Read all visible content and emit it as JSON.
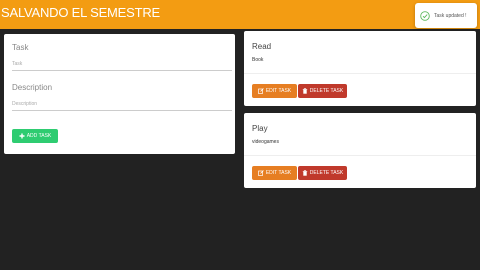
{
  "navbar": {
    "brand": "SALVANDO EL SEMESTRE"
  },
  "toast": {
    "message": "Task updated !",
    "icon": "check-circle-icon",
    "icon_color": "#5cb85c"
  },
  "form": {
    "title_label": "Task",
    "title_placeholder": "Task",
    "description_label": "Description",
    "description_placeholder": "Description",
    "add_button": "ADD TASK"
  },
  "tasks": [
    {
      "title": "Read",
      "description": "Book",
      "edit_label": "EDIT TASK",
      "delete_label": "DELETE TASK"
    },
    {
      "title": "Play",
      "description": "videogames",
      "edit_label": "EDIT TASK",
      "delete_label": "DELETE TASK"
    }
  ],
  "colors": {
    "navbar": "#f39c12",
    "background": "#222222",
    "add": "#2ecc71",
    "edit": "#e67e22",
    "delete": "#c0392b"
  }
}
